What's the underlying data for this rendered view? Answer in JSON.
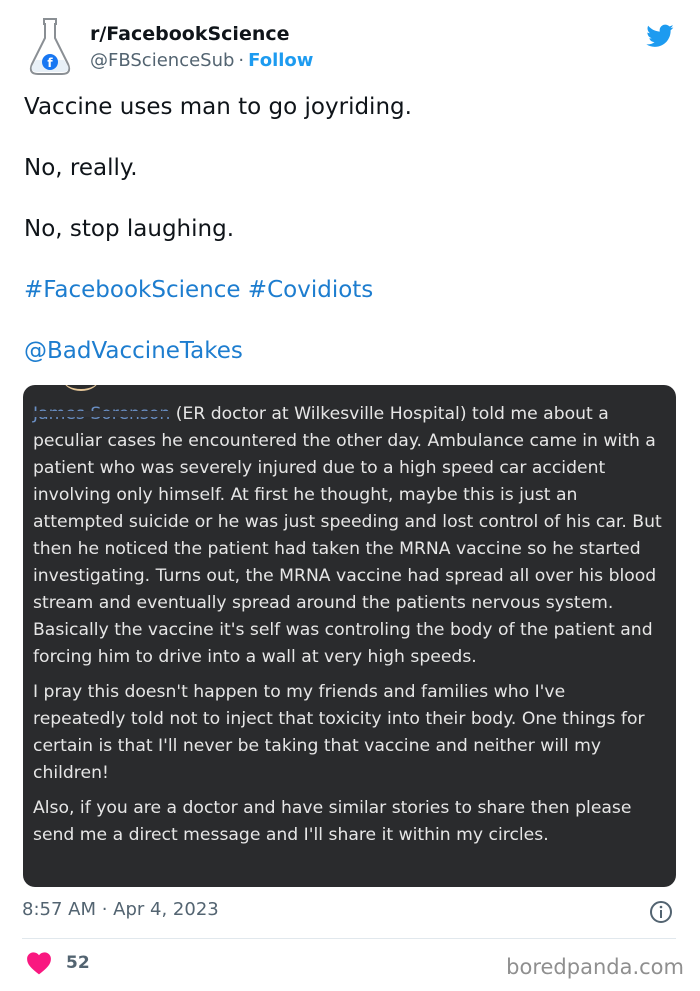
{
  "author": {
    "name": "r/FacebookScience",
    "handle": "@FBScienceSub",
    "separator": "·",
    "follow_label": "Follow"
  },
  "tweet": {
    "lines": [
      "Vaccine uses man to go joyriding.",
      "No, really.",
      "No, stop laughing."
    ],
    "hashtags": "#FacebookScience #Covidiots",
    "mention": "@BadVaccineTakes"
  },
  "screenshot": {
    "redacted_name": "James Sorenson",
    "paragraph1_rest": "(ER doctor at Wilkesville Hospital) told me about a peculiar cases he encountered the other day. Ambulance came in with a patient who was severely injured due to a high speed car accident involving only himself. At first he thought, maybe this is just an attempted suicide or he was just speeding and lost control of his car. But then he noticed the patient had taken the MRNA vaccine so he started investigating. Turns out, the MRNA vaccine had spread all over his blood stream and eventually spread around the patients nervous system. Basically the vaccine it's self was controling the body of the patient and forcing him to drive into a wall at very high speeds.",
    "paragraph2": "I pray this doesn't happen to my friends and families who I've repeatedly told not to inject that toxicity into their body. One things for certain is that I'll never be taking that vaccine and neither will my children!",
    "paragraph3": "Also, if you are a doctor and have similar stories to share then please send me a direct message and I'll share it within my circles."
  },
  "meta": {
    "timestamp": "8:57 AM · Apr 4, 2023",
    "like_count": "52",
    "watermark": "boredpanda.com"
  },
  "colors": {
    "link": "#1d9bf0",
    "heart": "#f91880",
    "screenshot_bg": "#2a2b2d"
  },
  "icons": [
    "flask-facebook-avatar",
    "twitter-bird-icon",
    "info-icon",
    "heart-icon"
  ]
}
